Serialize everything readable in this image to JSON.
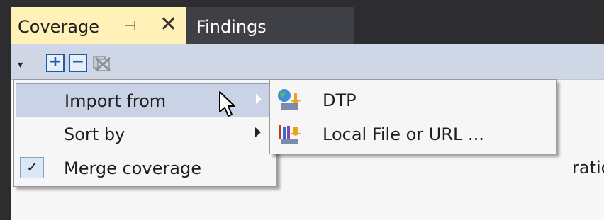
{
  "tabs": {
    "coverage": {
      "label": "Coverage",
      "pin_glyph": "⊣",
      "close_glyph": "✕"
    },
    "findings": {
      "label": "Findings"
    }
  },
  "toolbar": {
    "dropdown_glyph": "▾",
    "expand_glyph": "+",
    "collapse_glyph": "−"
  },
  "context_menu": {
    "items": [
      {
        "label": "Import from",
        "has_submenu": true,
        "highlighted": true
      },
      {
        "label": "Sort by",
        "has_submenu": true
      },
      {
        "label": "Merge coverage",
        "checked": true,
        "check_glyph": "✓"
      }
    ]
  },
  "submenu": {
    "items": [
      {
        "label": "DTP",
        "icon": "dtp-import-icon"
      },
      {
        "label": "Local File or URL ...",
        "icon": "local-file-import-icon"
      }
    ]
  },
  "background_partial_text": "ration",
  "colors": {
    "active_tab": "#fff1b8",
    "inactive_tab": "#3f3f46",
    "toolbar": "#cfd6e5",
    "menu_highlight": "#c9d3e5",
    "icon_blue": "#1e5ea8"
  }
}
